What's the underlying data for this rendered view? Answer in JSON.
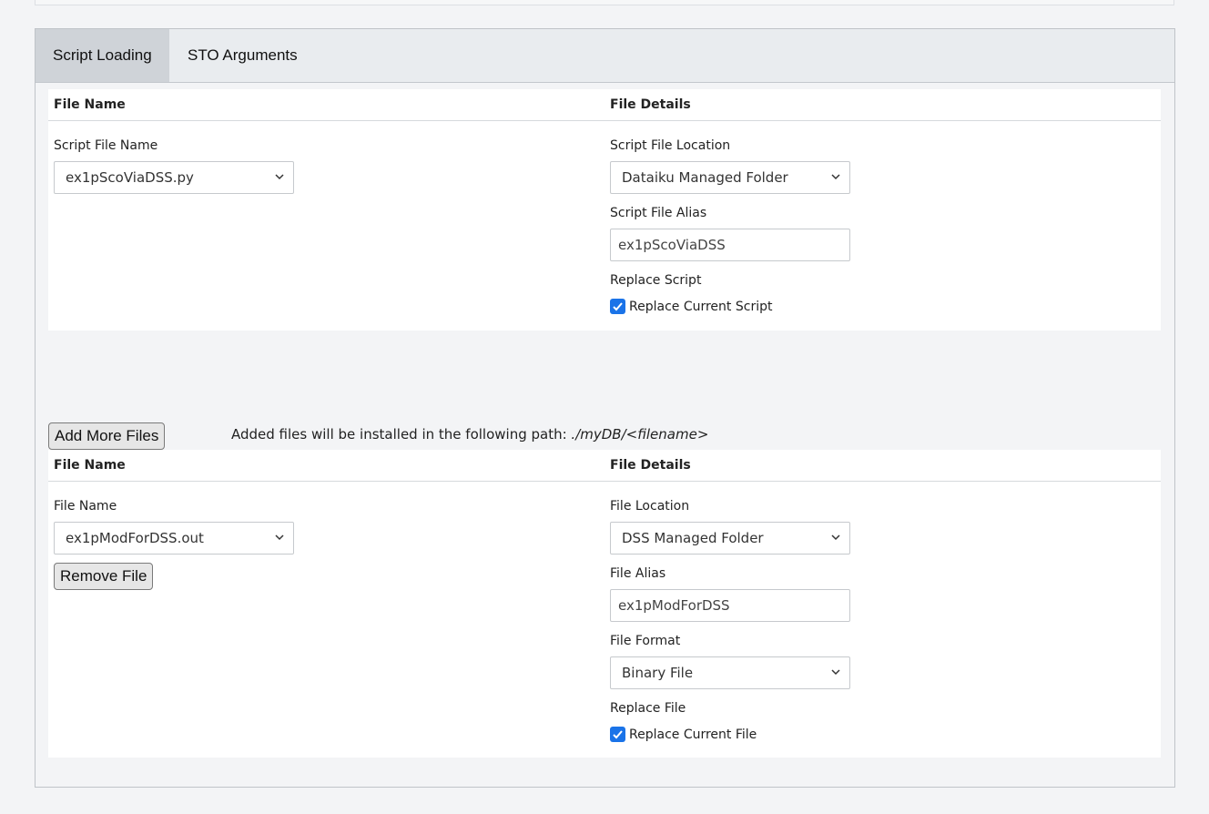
{
  "tabs": [
    {
      "label": "Script Loading",
      "active": true
    },
    {
      "label": "STO Arguments",
      "active": false
    }
  ],
  "script_section": {
    "col_file_name": "File Name",
    "col_file_details": "File Details",
    "script_file_name_label": "Script File Name",
    "script_file_name_value": "ex1pScoViaDSS.py",
    "script_file_location_label": "Script File Location",
    "script_file_location_value": "Dataiku Managed Folder",
    "script_file_alias_label": "Script File Alias",
    "script_file_alias_value": "ex1pScoViaDSS",
    "replace_script_label": "Replace Script",
    "replace_script_checkbox_label": "Replace Current Script",
    "replace_script_checked": true
  },
  "add_files": {
    "button_label": "Add More Files",
    "note_text": "Added files will be installed in the following path: ",
    "note_path": "./myDB/<filename>"
  },
  "file_section": {
    "col_file_name": "File Name",
    "col_file_details": "File Details",
    "file_name_label": "File Name",
    "file_name_value": "ex1pModForDSS.out",
    "remove_button_label": "Remove File",
    "file_location_label": "File Location",
    "file_location_value": "DSS Managed Folder",
    "file_alias_label": "File Alias",
    "file_alias_value": "ex1pModForDSS",
    "file_format_label": "File Format",
    "file_format_value": "Binary File",
    "replace_file_label": "Replace File",
    "replace_file_checkbox_label": "Replace Current File",
    "replace_file_checked": true
  },
  "colors": {
    "accent": "#1a73e8",
    "tab_active_bg": "#cfd3d8",
    "tabbar_bg": "#e9ecef"
  }
}
